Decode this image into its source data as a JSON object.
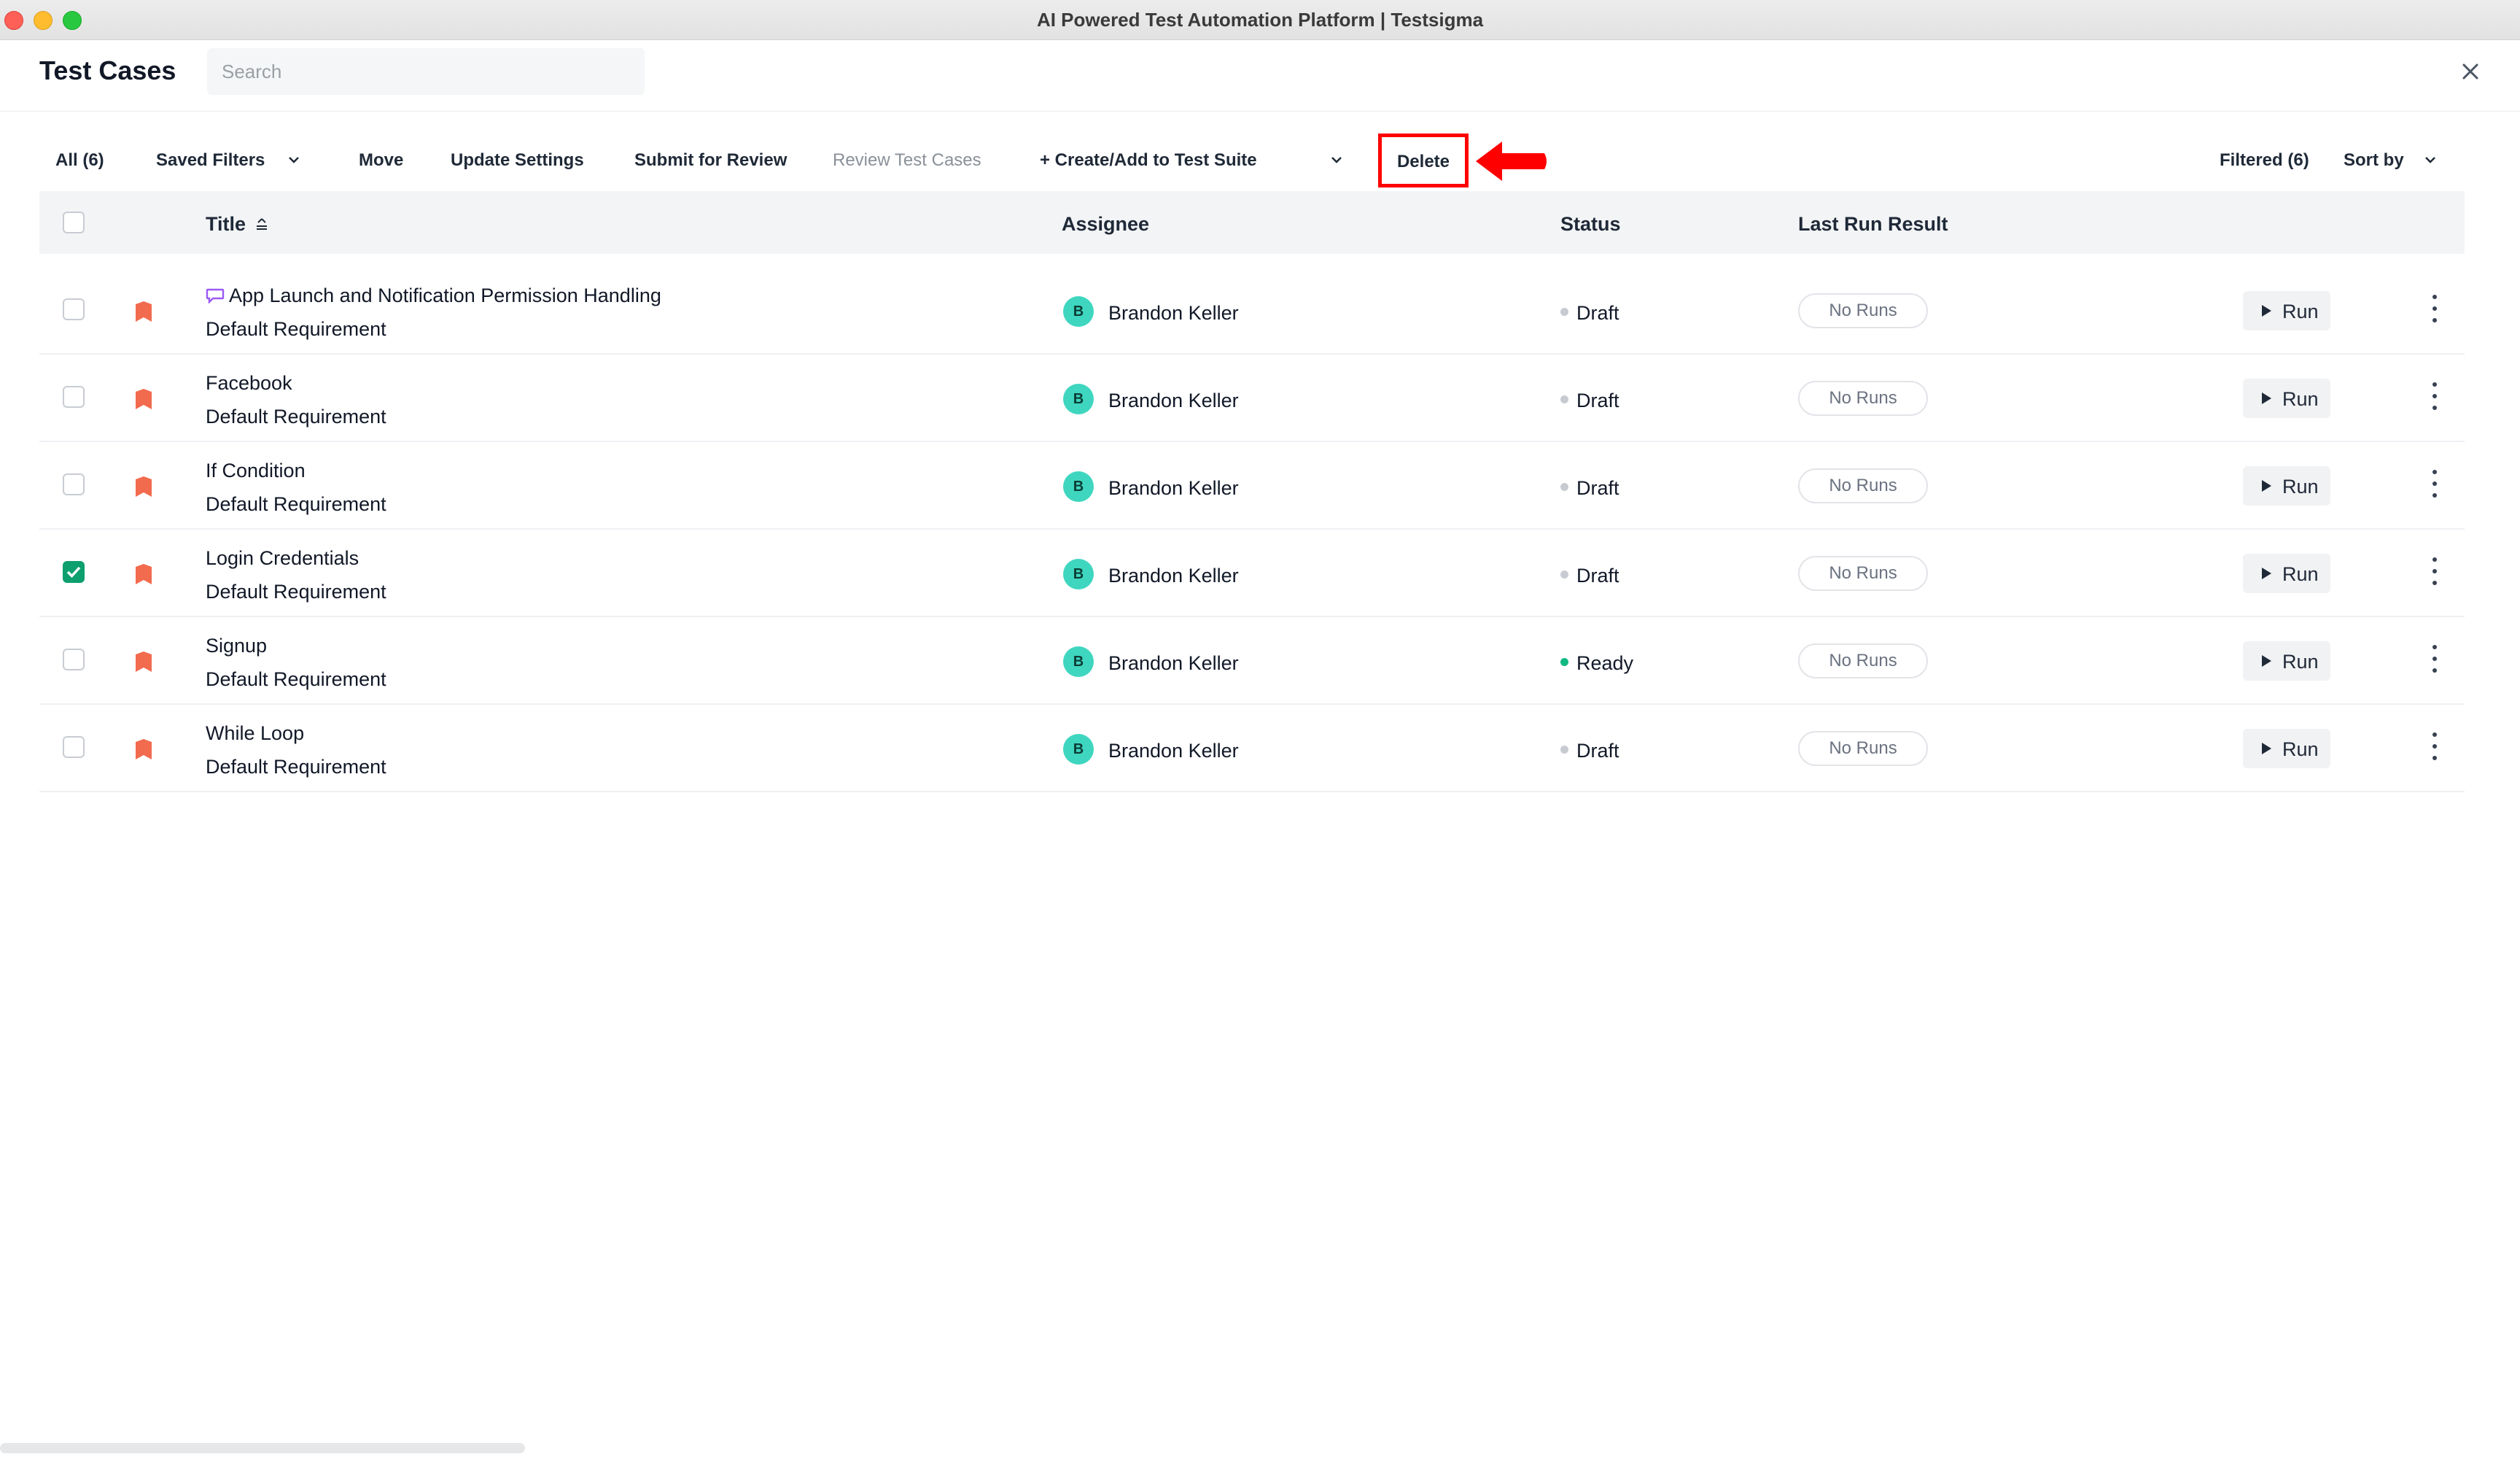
{
  "window": {
    "title": "AI Powered Test Automation Platform | Testsigma"
  },
  "header": {
    "title": "Test Cases",
    "search_placeholder": "Search"
  },
  "toolbar": {
    "all": "All (6)",
    "saved_filters": "Saved Filters",
    "move": "Move",
    "update_settings": "Update Settings",
    "submit_for_review": "Submit for Review",
    "review_test_cases": "Review Test Cases",
    "create_add_suite": "+ Create/Add to Test Suite",
    "delete": "Delete",
    "filtered": "Filtered (6)",
    "sort_by": "Sort by"
  },
  "table": {
    "columns": {
      "title": "Title",
      "assignee": "Assignee",
      "status": "Status",
      "last_run": "Last Run Result"
    },
    "rows": [
      {
        "title": "App Launch and Notification Permission Handling",
        "requirement": "Default Requirement",
        "assignee": "Brandon Keller",
        "avatar": "B",
        "status": "Draft",
        "last_run": "No Runs",
        "run": "Run",
        "checked": false,
        "has_comment": true
      },
      {
        "title": "Facebook",
        "requirement": "Default Requirement",
        "assignee": "Brandon Keller",
        "avatar": "B",
        "status": "Draft",
        "last_run": "No Runs",
        "run": "Run",
        "checked": false
      },
      {
        "title": "If Condition",
        "requirement": "Default Requirement",
        "assignee": "Brandon Keller",
        "avatar": "B",
        "status": "Draft",
        "last_run": "No Runs",
        "run": "Run",
        "checked": false
      },
      {
        "title": "Login Credentials",
        "requirement": "Default Requirement",
        "assignee": "Brandon Keller",
        "avatar": "B",
        "status": "Draft",
        "last_run": "No Runs",
        "run": "Run",
        "checked": true
      },
      {
        "title": "Signup",
        "requirement": "Default Requirement",
        "assignee": "Brandon Keller",
        "avatar": "B",
        "status": "Ready",
        "last_run": "No Runs",
        "run": "Run",
        "checked": false
      },
      {
        "title": "While Loop",
        "requirement": "Default Requirement",
        "assignee": "Brandon Keller",
        "avatar": "B",
        "status": "Draft",
        "last_run": "No Runs",
        "run": "Run",
        "checked": false
      }
    ]
  },
  "colors": {
    "accent_green": "#0d9f6e",
    "ready_dot": "#10b981",
    "priority_flag": "#f26b4f",
    "highlight_red": "#ff0000",
    "avatar_bg": "#3fd6c0"
  }
}
